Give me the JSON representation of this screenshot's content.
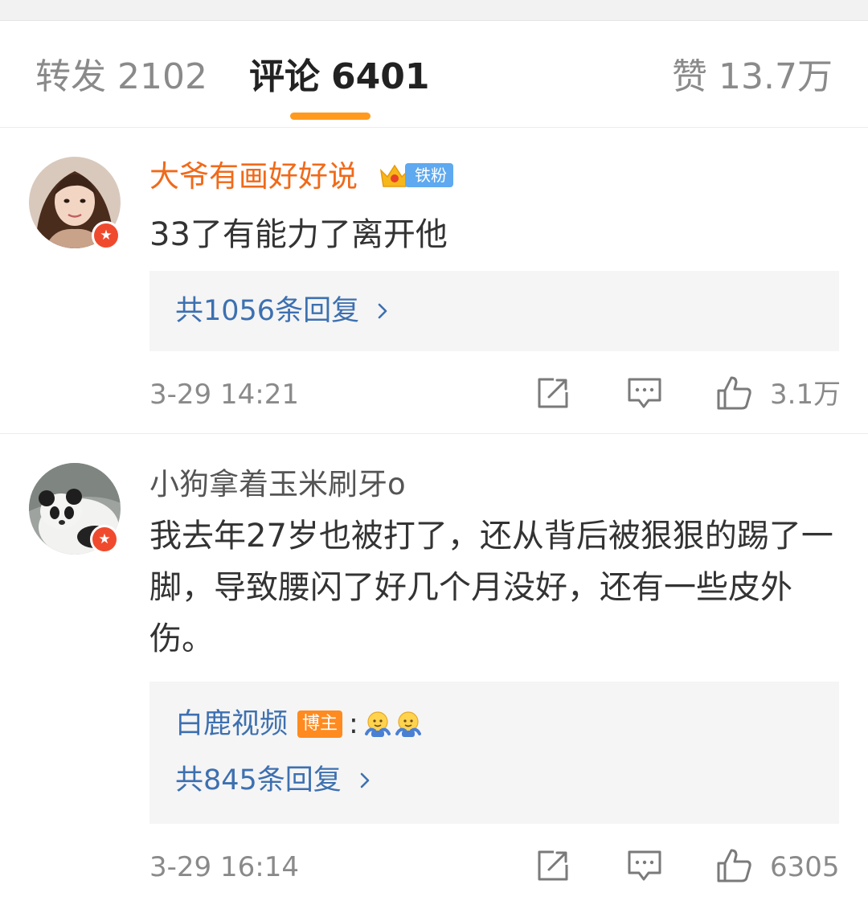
{
  "tabs": {
    "repost": {
      "label": "转发",
      "count": "2102"
    },
    "comment": {
      "label": "评论",
      "count": "6401"
    },
    "like": {
      "label": "赞",
      "count": "13.7万"
    }
  },
  "comments": [
    {
      "username": "大爷有画好好说",
      "fan_badge": "铁粉",
      "text": "33了有能力了离开他",
      "more_replies": "共1056条回复",
      "time": "3-29 14:21",
      "likes": "3.1万",
      "avatar_icon": "woman-portrait-avatar",
      "verified_icon": "verified-star-badge"
    },
    {
      "username": "小狗拿着玉米刷牙o",
      "text": "我去年27岁也被打了，还从背后被狠狠的踢了一脚，导致腰闪了好几个月没好，还有一些皮外伤。",
      "reply_preview": {
        "user": "白鹿视频",
        "tag": "博主",
        "colon": ":",
        "emoji": [
          "hug-emoji",
          "hug-emoji"
        ]
      },
      "more_replies": "共845条回复",
      "time": "3-29 16:14",
      "likes": "6305",
      "avatar_icon": "panda-avatar",
      "verified_icon": "verified-star-badge"
    }
  ],
  "colors": {
    "accent_orange": "#ff9a1f",
    "username_orange": "#f06a1a",
    "link_blue": "#3d70b0",
    "fan_badge_blue": "#5ea9ef",
    "blogger_tag": "#ff8a1f"
  },
  "icons": [
    "share-icon",
    "comment-icon",
    "thumbs-up-icon",
    "chevron-right-icon",
    "crown-icon"
  ]
}
